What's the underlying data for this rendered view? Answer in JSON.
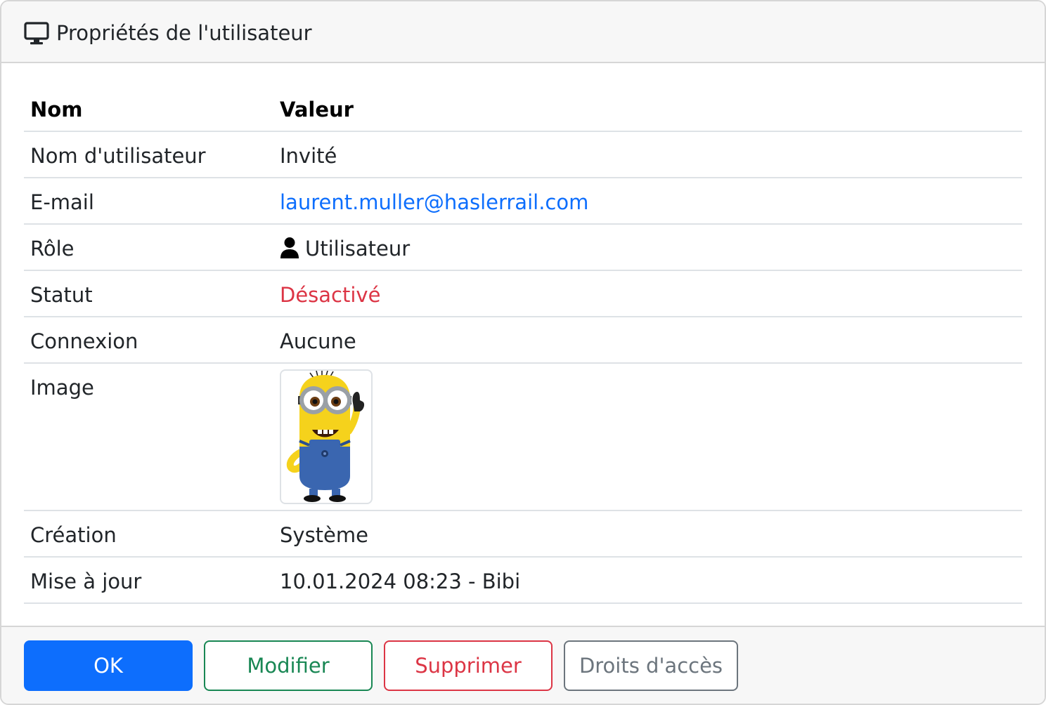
{
  "dialog": {
    "title": "Propriétés de l'utilisateur",
    "title_icon": "monitor-icon"
  },
  "table": {
    "headers": {
      "name": "Nom",
      "value": "Valeur"
    },
    "rows": {
      "username": {
        "label": "Nom d'utilisateur",
        "value": "Invité"
      },
      "email": {
        "label": "E-mail",
        "value": "laurent.muller@haslerrail.com"
      },
      "role": {
        "label": "Rôle",
        "value": "Utilisateur",
        "icon": "user-icon"
      },
      "status": {
        "label": "Statut",
        "value": "Désactivé"
      },
      "login": {
        "label": "Connexion",
        "value": "Aucune"
      },
      "image": {
        "label": "Image",
        "alt": "minion-avatar"
      },
      "created": {
        "label": "Création",
        "value": "Système"
      },
      "updated": {
        "label": "Mise à jour",
        "value": "10.01.2024 08:23 - Bibi"
      }
    }
  },
  "footer": {
    "ok_label": "OK",
    "edit_label": "Modifier",
    "delete_label": "Supprimer",
    "rights_label": "Droits d'accès"
  },
  "colors": {
    "primary": "#0d6efd",
    "success": "#198754",
    "danger": "#dc3545",
    "secondary": "#6c757d"
  }
}
